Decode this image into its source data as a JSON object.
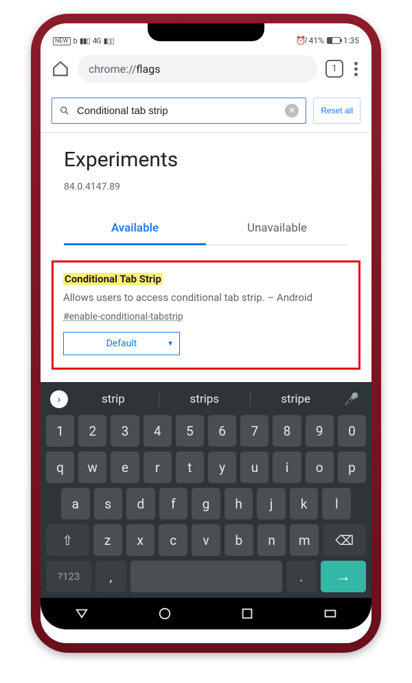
{
  "status": {
    "carrier_badge": "NEW",
    "data_label": "b",
    "signal_4g": "4G",
    "alarm_off": true,
    "battery_pct": "41%",
    "time": "1:35"
  },
  "browser": {
    "url_prefix": "chrome://",
    "url_path": "flags",
    "tab_count": "1"
  },
  "flags": {
    "search_value": "Conditional tab strip",
    "reset_label": "Reset all",
    "page_title": "Experiments",
    "version": "84.0.4147.89",
    "tab_available": "Available",
    "tab_unavailable": "Unavailable",
    "result": {
      "name": "Conditional Tab Strip",
      "description": "Allows users to access conditional tab strip. – Android",
      "id": "#enable-conditional-tabstrip",
      "select_value": "Default"
    }
  },
  "keyboard": {
    "suggestions": [
      "strip",
      "strips",
      "stripe"
    ],
    "row_num": [
      "1",
      "2",
      "3",
      "4",
      "5",
      "6",
      "7",
      "8",
      "9",
      "0"
    ],
    "row1": [
      "q",
      "w",
      "e",
      "r",
      "t",
      "y",
      "u",
      "i",
      "o",
      "p"
    ],
    "row2": [
      "a",
      "s",
      "d",
      "f",
      "g",
      "h",
      "j",
      "k",
      "l"
    ],
    "row3": [
      "z",
      "x",
      "c",
      "v",
      "b",
      "n",
      "m"
    ],
    "sym_key": "?123",
    "comma_key": ",",
    "period_key": ".",
    "enter_glyph": "→"
  }
}
